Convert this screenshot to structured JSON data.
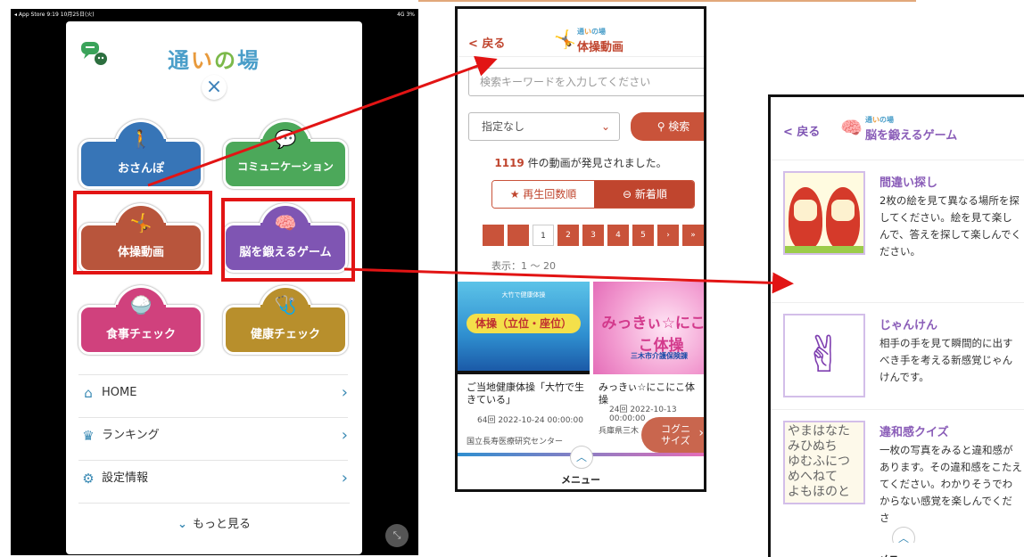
{
  "tablet": {
    "status_left": "◂ App Store  9:19  10月25日(火)",
    "status_right": "4G 3%",
    "app_title": {
      "c1": "通",
      "c2": "い",
      "c3": "の",
      "c4": "場"
    },
    "close": "×",
    "tiles": [
      {
        "label": "おさんぽ",
        "icon": "walking-person-icon",
        "glyph": "🚶"
      },
      {
        "label": "コミュニケーション",
        "icon": "chat-bubble-icon",
        "glyph": "💬"
      },
      {
        "label": "体操動画",
        "icon": "exercise-person-icon",
        "glyph": "🤸"
      },
      {
        "label": "脳を鍛えるゲーム",
        "icon": "brain-icon",
        "glyph": "🧠"
      },
      {
        "label": "食事チェック",
        "icon": "rice-bowl-icon",
        "glyph": "🍚"
      },
      {
        "label": "健康チェック",
        "icon": "stethoscope-icon",
        "glyph": "🩺"
      }
    ],
    "nav": [
      {
        "label": "HOME",
        "icon": "home-icon",
        "glyph": "⌂"
      },
      {
        "label": "ランキング",
        "icon": "crown-icon",
        "glyph": "♛"
      },
      {
        "label": "設定情報",
        "icon": "user-settings-icon",
        "glyph": "⚙"
      }
    ],
    "more": "もっと見る"
  },
  "video_screen": {
    "back": "< 戻る",
    "header_small": {
      "c1": "通",
      "c2": "い",
      "c3": "の場"
    },
    "header_title": "体操動画",
    "search_placeholder": "検索キーワードを入力してください",
    "filter_value": "指定なし",
    "search_button": "検索",
    "count_number": "1119",
    "count_text": "件の動画が発見されました。",
    "sort_play": "再生回数順",
    "sort_new": "新着順",
    "pages": [
      "",
      "",
      "1",
      "2",
      "3",
      "4",
      "5",
      "›",
      "»"
    ],
    "range": "表示：1 ～ 20",
    "videos": [
      {
        "thumb_sub": "大竹で健康体操",
        "thumb_main": "体操（立位・座位）",
        "title": "ご当地健康体操「大竹で生きている」",
        "views": "64回",
        "date": "2022-10-24 00:00:00",
        "org": "国立長寿医療研究センター"
      },
      {
        "thumb_main": "みっきぃ☆にこにこ体操",
        "thumb_org": "三木市介護保険課",
        "title": "みっきぃ☆にこにこ体操",
        "views": "24回",
        "date": "2022-10-13 00:00:00",
        "org": "兵庫県三木"
      }
    ],
    "cog_label": "コグニサイズ",
    "menu": "メニュー"
  },
  "game_screen": {
    "back": "< 戻る",
    "header_small": {
      "c1": "通",
      "c2": "い",
      "c3": "の場"
    },
    "header_title": "脳を鍛えるゲーム",
    "games": [
      {
        "title": "間違い探し",
        "desc": "2枚の絵を見て異なる場所を探してください。絵を見て楽しんで、答えを探して楽しんでください。"
      },
      {
        "title": "じゃんけん",
        "desc": "相手の手を見て瞬間的に出すべき手を考える新感覚じゃんけんです。"
      },
      {
        "title": "違和感クイズ",
        "desc": "一枚の写真をみると違和感があります。その違和感をこたえてください。わかりそうでわからない感覚を楽しんでくださ",
        "img_text": "やまはなた\nみひぬち\nゆむふにつ\nめへねて\nよもほのと"
      }
    ],
    "menu": "メニュー"
  },
  "colors": {
    "highlight": "#e21414",
    "video_accent": "#c0452e",
    "game_accent": "#7f55b3",
    "nav_accent": "#3a8ab4"
  }
}
